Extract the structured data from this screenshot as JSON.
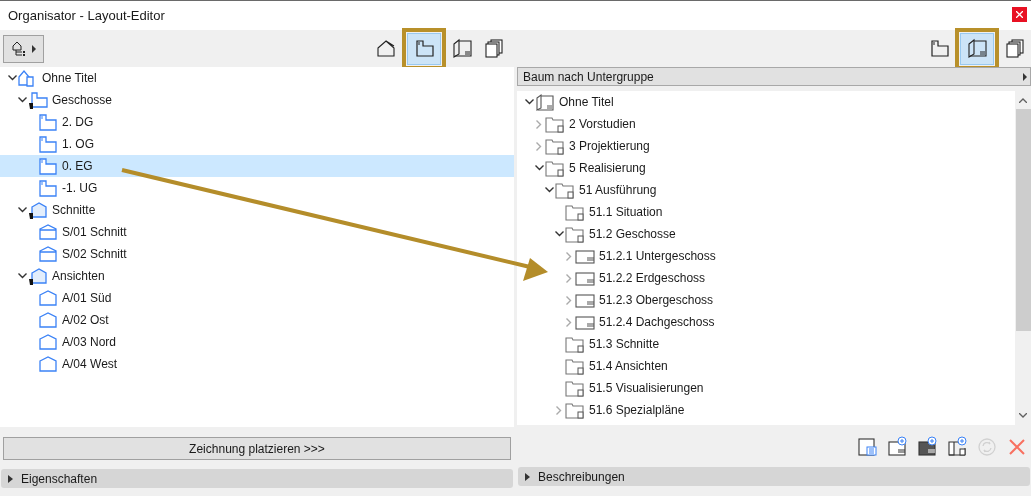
{
  "window": {
    "title": "Organisator - Layout-Editor"
  },
  "left_panel": {
    "toolbar": {
      "views": [
        {
          "kind": "project",
          "selected": false
        },
        {
          "kind": "story",
          "selected": true
        },
        {
          "kind": "book",
          "selected": false
        },
        {
          "kind": "publisher",
          "selected": false
        }
      ]
    },
    "tree": [
      {
        "label": "Ohne Titel",
        "kind": "project",
        "expanded": true,
        "selected": false,
        "children": [
          {
            "label": "Geschosse",
            "kind": "story-group",
            "expanded": true,
            "selected": false,
            "children": [
              {
                "label": "2. DG",
                "kind": "story",
                "selected": false
              },
              {
                "label": "1. OG",
                "kind": "story",
                "selected": false
              },
              {
                "label": "0. EG",
                "kind": "story",
                "selected": true
              },
              {
                "label": "-1. UG",
                "kind": "story",
                "selected": false
              }
            ]
          },
          {
            "label": "Schnitte",
            "kind": "section-group",
            "expanded": true,
            "selected": false,
            "children": [
              {
                "label": "S/01 Schnitt",
                "kind": "section",
                "selected": false
              },
              {
                "label": "S/02 Schnitt",
                "kind": "section",
                "selected": false
              }
            ]
          },
          {
            "label": "Ansichten",
            "kind": "section-group",
            "expanded": true,
            "selected": false,
            "children": [
              {
                "label": "A/01 Süd",
                "kind": "elevation",
                "selected": false
              },
              {
                "label": "A/02 Ost",
                "kind": "elevation",
                "selected": false
              },
              {
                "label": "A/03 Nord",
                "kind": "elevation",
                "selected": false
              },
              {
                "label": "A/04 West",
                "kind": "elevation",
                "selected": false
              }
            ]
          }
        ]
      }
    ],
    "place_button": "Zeichnung platzieren >>>",
    "section": {
      "label": "Eigenschaften",
      "expanded": false
    }
  },
  "right_panel": {
    "toolbar": {
      "views": [
        {
          "kind": "story",
          "selected": false
        },
        {
          "kind": "book",
          "selected": true
        },
        {
          "kind": "publisher",
          "selected": false
        }
      ]
    },
    "dropdown": "Baum nach Untergruppe",
    "tree": [
      {
        "label": "Ohne Titel",
        "kind": "book",
        "expanded": true,
        "selected": false,
        "children": [
          {
            "label": "2 Vorstudien",
            "kind": "folder",
            "expanded": false,
            "selected": false
          },
          {
            "label": "3 Projektierung",
            "kind": "folder",
            "expanded": false,
            "selected": false
          },
          {
            "label": "5 Realisierung",
            "kind": "folder",
            "expanded": true,
            "selected": false,
            "children": [
              {
                "label": "51 Ausführung",
                "kind": "folder",
                "expanded": true,
                "selected": false,
                "children": [
                  {
                    "label": "51.1 Situation",
                    "kind": "folder",
                    "selected": false
                  },
                  {
                    "label": "51.2 Geschosse",
                    "kind": "folder",
                    "expanded": true,
                    "selected": false,
                    "children": [
                      {
                        "label": "51.2.1 Untergeschoss",
                        "kind": "layout",
                        "expanded": false,
                        "selected": false
                      },
                      {
                        "label": "51.2.2 Erdgeschoss",
                        "kind": "layout",
                        "expanded": false,
                        "selected": false
                      },
                      {
                        "label": "51.2.3 Obergeschoss",
                        "kind": "layout",
                        "expanded": false,
                        "selected": false
                      },
                      {
                        "label": "51.2.4 Dachgeschoss",
                        "kind": "layout",
                        "expanded": false,
                        "selected": false
                      }
                    ]
                  },
                  {
                    "label": "51.3 Schnitte",
                    "kind": "folder",
                    "selected": false
                  },
                  {
                    "label": "51.4 Ansichten",
                    "kind": "folder",
                    "selected": false
                  },
                  {
                    "label": "51.5 Visualisierungen",
                    "kind": "folder",
                    "selected": false
                  },
                  {
                    "label": "51.6 Spezialpläne",
                    "kind": "folder",
                    "expanded": false,
                    "selected": false
                  }
                ]
              }
            ]
          }
        ]
      }
    ],
    "actions": [
      {
        "kind": "layout-list",
        "disabled": false
      },
      {
        "kind": "new-layout",
        "disabled": false
      },
      {
        "kind": "new-master",
        "disabled": false
      },
      {
        "kind": "new-folder",
        "disabled": false
      },
      {
        "kind": "refresh",
        "disabled": true
      },
      {
        "kind": "delete",
        "disabled": false
      }
    ],
    "section": {
      "label": "Beschreibungen",
      "expanded": false
    }
  }
}
